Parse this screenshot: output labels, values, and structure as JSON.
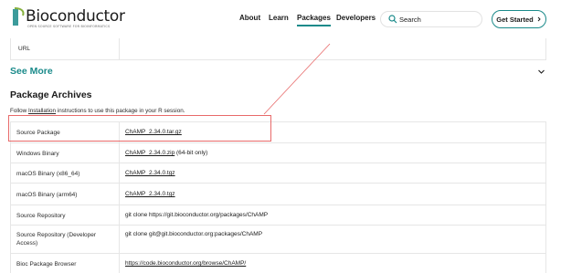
{
  "header": {
    "logo_text": "Bioconductor",
    "logo_tagline": "OPEN SOURCE SOFTWARE FOR BIOINFORMATICS",
    "nav": [
      {
        "label": "About",
        "active": false
      },
      {
        "label": "Learn",
        "active": false
      },
      {
        "label": "Packages",
        "active": true
      },
      {
        "label": "Developers",
        "active": false
      }
    ],
    "search_placeholder": "Search",
    "get_started_label": "Get Started",
    "accent_color": "#1a8a8a"
  },
  "details": {
    "url_label": "URL",
    "see_more_label": "See More"
  },
  "archives": {
    "title": "Package Archives",
    "instructions_before": "Follow ",
    "instructions_link": "Installation",
    "instructions_after": " instructions to use this package in your R session.",
    "rows": [
      {
        "label": "Source Package",
        "link": "ChAMP_2.34.0.tar.gz",
        "suffix": ""
      },
      {
        "label": "Windows Binary",
        "link": "ChAMP_2.34.0.zip",
        "suffix": " (64-bit only)"
      },
      {
        "label": "macOS Binary (x86_64)",
        "link": "ChAMP_2.34.0.tgz",
        "suffix": ""
      },
      {
        "label": "macOS Binary (arm64)",
        "link": "ChAMP_2.34.0.tgz",
        "suffix": ""
      },
      {
        "label": "Source Repository",
        "link": "",
        "suffix": "git clone https://git.bioconductor.org/packages/ChAMP"
      },
      {
        "label": "Source Repository (Developer Access)",
        "link": "",
        "suffix": "git clone git@git.bioconductor.org:packages/ChAMP"
      },
      {
        "label": "Bioc Package Browser",
        "link": "https://code.bioconductor.org/browse/ChAMP/",
        "suffix": ""
      }
    ]
  },
  "annotation": {
    "color": "#e86a6a"
  }
}
